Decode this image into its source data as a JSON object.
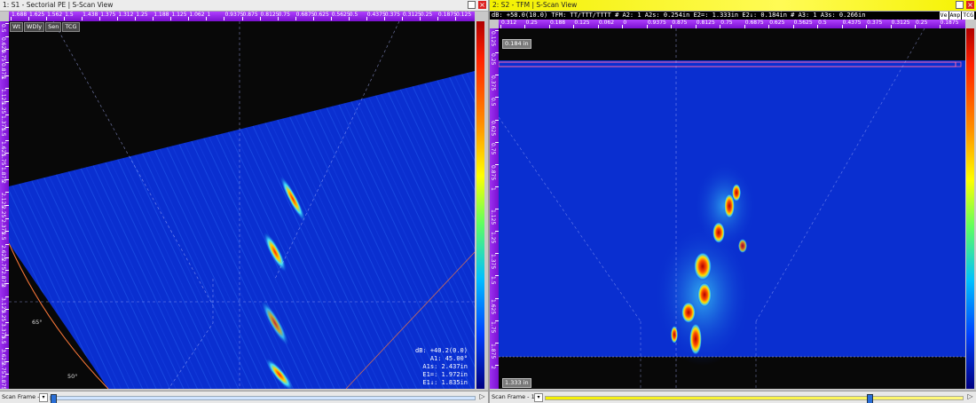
{
  "left": {
    "title": "1: S1 - Sectorial PE | S-Scan View",
    "ruler_top_labels": [
      "1.688",
      "1.625",
      "1.562",
      "1.5",
      "1.438",
      "1.375",
      "1.312",
      "1.25",
      "1.188",
      "1.125",
      "1.062",
      "1",
      "0.9375",
      "0.875",
      "0.8125",
      "0.75",
      "0.6875",
      "0.625",
      "0.5625",
      "0.5",
      "0.4375",
      "0.375",
      "0.3125",
      "0.25",
      "0.1875",
      "0.125"
    ],
    "ruler_left_labels": [
      "0.5",
      "0.625",
      "0.75",
      "0.875",
      "1",
      "1.125",
      "1.25",
      "1.375",
      "1.5",
      "1.625",
      "1.75",
      "1.875",
      "2",
      "2.125",
      "2.25",
      "2.375",
      "2.5",
      "2.625",
      "2.75",
      "2.875",
      "3",
      "3.125",
      "3.25",
      "3.375",
      "3.5",
      "3.625",
      "3.75",
      "3.875"
    ],
    "badges": [
      "Wt",
      "WDly",
      "Sen",
      "TCG"
    ],
    "angle_labels": [
      "65°",
      "50°"
    ],
    "readout": {
      "db": "dB: +40.2(0.0)",
      "a1": "A1: 45.00°",
      "a1s": "A1s: 2.437in",
      "e1eq": "E1=: 1.972in",
      "e1": "E1↓: 1.835in"
    },
    "scan_label": "Scan Frame - 1",
    "scan_value": 0.0
  },
  "right": {
    "title": "2: S2 - TFM | S-Scan View",
    "info": "dB: +58.0(10.0)  TFM: TT/TTT/TTTT  # A2: 1   A2s: 0.254in  E2=: 1.333in  E2↓: 0.184in  # A3: 1   A3s: 0.266in",
    "badges": [
      "Ve",
      "Amp",
      "TCG"
    ],
    "ruler_top_labels": [
      "0.312",
      "0.25",
      "0.188",
      "0.125",
      "0.062",
      "0",
      "0.9375",
      "0.875",
      "0.8125",
      "0.75",
      "0.6875",
      "0.625",
      "0.5625",
      "0.5",
      "0.4375",
      "0.375",
      "0.3125",
      "0.25",
      "0.1875"
    ],
    "ruler_left_labels": [
      "0.125",
      "0.25",
      "0.375",
      "0.5",
      "0.625",
      "0.75",
      "0.875",
      "1",
      "1.125",
      "1.25",
      "1.375",
      "1.5",
      "1.625",
      "1.75",
      "1.875",
      "2"
    ],
    "mark_top": "0.184 in",
    "mark_bottom": "1.333 in",
    "scan_label": "Scan Frame - 168",
    "scan_value": 0.78
  },
  "colors": {
    "accent_purple": "#8a20e0",
    "tfm_yellow": "#f4ef00",
    "scan_blue": "#0a2fd0"
  }
}
